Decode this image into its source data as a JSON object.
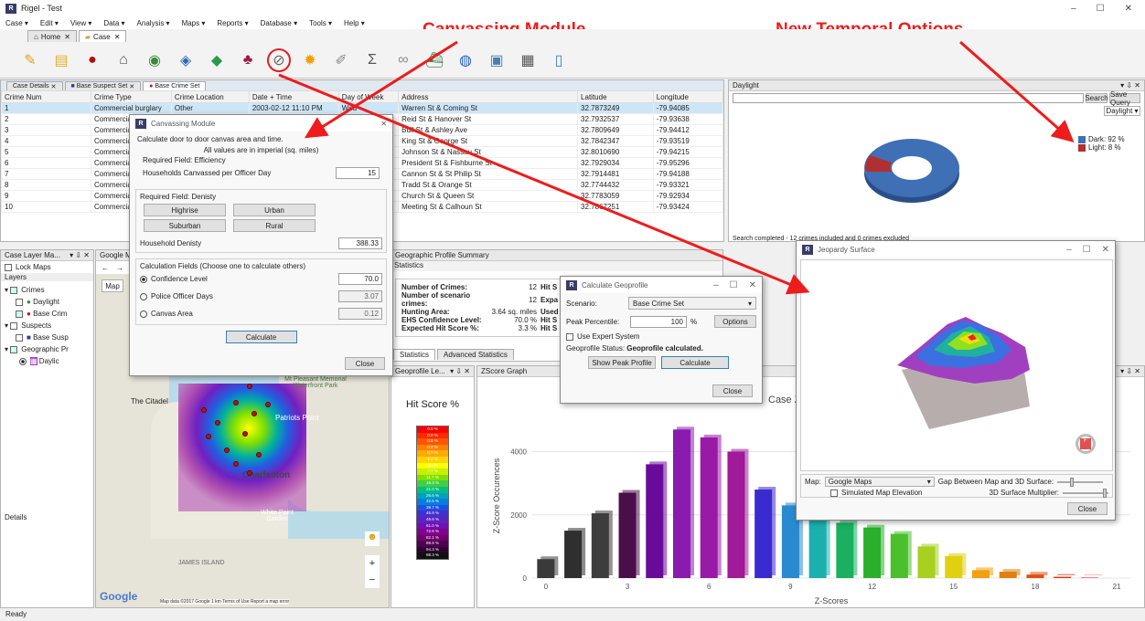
{
  "window": {
    "title": "Rigel - Test",
    "min": "–",
    "max": "☐",
    "close": "✕"
  },
  "menu": [
    "Case ▾",
    "Edit ▾",
    "View ▾",
    "Data ▾",
    "Analysis ▾",
    "Maps ▾",
    "Reports ▾",
    "Database ▾",
    "Tools ▾",
    "Help ▾"
  ],
  "doc_tabs": [
    {
      "label": "Home"
    },
    {
      "label": "Case"
    }
  ],
  "annotations": {
    "canvassing": "Canvassing Module",
    "temporal": "New Temporal Options"
  },
  "case_tabs": [
    {
      "label": "Case Details"
    },
    {
      "label": "Base Suspect Set"
    },
    {
      "label": "Base Crime Set"
    }
  ],
  "crime_table": {
    "columns": [
      "Crime Num",
      "Crime Type",
      "Crime Location",
      "Date + Time",
      "Day of Week",
      "Address",
      "Latitude",
      "Longitude"
    ],
    "rows": [
      [
        "1",
        "Commercial burglary",
        "Other",
        "2003-02-12 11:10 PM",
        "Wed",
        "Warren St & Coming St",
        "32.7873249",
        "-79.94085"
      ],
      [
        "2",
        "Commercial B",
        "",
        "",
        "",
        "Reid St & Hanover St",
        "32.7932537",
        "-79.93638"
      ],
      [
        "3",
        "Commercial B",
        "",
        "",
        "",
        "Bull St & Ashley Ave",
        "32.7809649",
        "-79.94412"
      ],
      [
        "4",
        "Commercial B",
        "",
        "",
        "",
        "King St & George St",
        "32.7842347",
        "-79.93519"
      ],
      [
        "5",
        "Commercial B",
        "",
        "",
        "",
        "Johnson St & Nassau St",
        "32.8010690",
        "-79.94215"
      ],
      [
        "6",
        "Commercial B",
        "",
        "",
        "",
        "President St & Fishburne St",
        "32.7929034",
        "-79.95296"
      ],
      [
        "7",
        "Commercial B",
        "",
        "",
        "",
        "Cannon St & St Philip St",
        "32.7914481",
        "-79.94188"
      ],
      [
        "8",
        "Commercial B",
        "",
        "",
        "",
        "Tradd St & Orange St",
        "32.7744432",
        "-79.93321"
      ],
      [
        "9",
        "Commercial B",
        "",
        "",
        "",
        "Church St & Queen St",
        "32.7783059",
        "-79.92934"
      ],
      [
        "10",
        "Commercial B",
        "",
        "",
        "",
        "Meeting St & Calhoun St",
        "32.7867251",
        "-79.93424"
      ]
    ]
  },
  "daylight": {
    "title": "Daylight",
    "search_label": "Search",
    "save_query_label": "Save Query",
    "dropdown_value": "Daylight",
    "legend": [
      {
        "label": "Dark: 92 %",
        "color": "#3f6fb5"
      },
      {
        "label": "Light: 8 %",
        "color": "#b03030"
      }
    ],
    "dark_pct": 92,
    "status": "Search completed - 12 crimes included and 0 crimes excluded"
  },
  "canvassing": {
    "title": "Canvassing Module",
    "intro": "Calculate door to door canvas area and time.",
    "units_note": "All values are in imperial (sq. miles)",
    "efficiency_group": "Required Field: Efficiency",
    "households_label": "Households Canvassed per Officer Day",
    "households_value": "15",
    "density_group": "Required Field: Denisty",
    "density_buttons": [
      "Highrise",
      "Urban",
      "Suburban",
      "Rural"
    ],
    "household_density_label": "Household Denisty",
    "household_density_value": "388.33",
    "calc_group": "Calculation Fields (Choose one to calculate others)",
    "confidence_label": "Confidence Level",
    "confidence_value": "70.0",
    "officer_days_label": "Police Officer Days",
    "officer_days_value": "3.07",
    "canvas_area_label": "Canvas Area",
    "canvas_area_value": "0.12",
    "calculate_label": "Calculate",
    "close_label": "Close"
  },
  "layers": {
    "panel_title": "Case Layer Ma...",
    "lock_maps": "Lock Maps",
    "layers_label": "Layers",
    "items": [
      "Crimes",
      "Daylight",
      "Base Crim",
      "Suspects",
      "Base Susp",
      "Geographic Pr",
      "Daylic"
    ],
    "details_label": "Details"
  },
  "map": {
    "title": "Google M",
    "type_button": "Map",
    "labels": [
      "The Citadel",
      "Patriots Point",
      "Mt Pleasant Memorial Waterfront Park",
      "Charleston",
      "White Point Garden",
      "JAMES ISLAND"
    ],
    "footer": "Map data ©2017 Google   1 km   Terms of Use   Report a map error",
    "logo": "Google"
  },
  "geo_summary": {
    "title": "Geographic Profile Summary",
    "stats_header": "Statistics",
    "rows": [
      {
        "label": "Number of Crimes:",
        "value": "12",
        "extra": "Hit S"
      },
      {
        "label": "Number of scenario crimes:",
        "value": "12",
        "extra": "Expa"
      },
      {
        "label": "Hunting Area:",
        "value": "3.64 sq. miles",
        "extra": "Used"
      },
      {
        "label": "EHS Confidence Level:",
        "value": "70.0 %",
        "extra": "Hit S"
      },
      {
        "label": "Expected Hit Score %:",
        "value": "3.3 %",
        "extra": "Hit S"
      }
    ],
    "tabs": [
      "Statistics",
      "Advanced Statistics"
    ]
  },
  "calc_geo": {
    "title": "Calculate Geoprofile",
    "scenario_label": "Scenario:",
    "scenario_value": "Base Crime Set",
    "peak_label": "Peak Percentile:",
    "peak_value": "100",
    "peak_unit": "%",
    "options_label": "Options",
    "expert_label": "Use Expert System",
    "status_label": "Geoprofile Status:",
    "status_value": "Geoprofile calculated.",
    "show_peak_label": "Show Peak Profile",
    "calculate_label": "Calculate",
    "close_label": "Close"
  },
  "hit_legend": {
    "panel_title": "Geoprofile Le...",
    "title": "Hit Score %",
    "items": [
      "0.0 %",
      "0.0 %",
      "0.0 %",
      "0.2 %",
      "0.7 %",
      "1.4 %",
      "4.6 %",
      "7.7 %",
      "11.7 %",
      "16.3 %",
      "21.0 %",
      "26.6 %",
      "32.5 %",
      "38.7 %",
      "45.9 %",
      "49.6 %",
      "61.0 %",
      "72.8 %",
      "82.1 %",
      "88.9 %",
      "94.3 %",
      "98.3 %"
    ],
    "colors": [
      "#ff0000",
      "#ff2a00",
      "#ff5500",
      "#ff8000",
      "#ffaa00",
      "#ffd400",
      "#ffff00",
      "#c8f000",
      "#80e000",
      "#40d040",
      "#00c080",
      "#00a0c0",
      "#0080e0",
      "#2050e0",
      "#4030d0",
      "#6020c0",
      "#7010b0",
      "#800090",
      "#700070",
      "#500050",
      "#300030",
      "#101010"
    ]
  },
  "zscore": {
    "title": "ZScore Graph",
    "chart_title": "Case Z"
  },
  "chart_data": {
    "type": "bar",
    "title": "Case Z",
    "xlabel": "Z-Scores",
    "ylabel": "Z-Score Occurences",
    "x": [
      0,
      1,
      2,
      3,
      4,
      5,
      6,
      7,
      8,
      9,
      10,
      11,
      12,
      13,
      14,
      15,
      16,
      17,
      18,
      19,
      20,
      21
    ],
    "values": [
      600,
      1500,
      2050,
      2700,
      3600,
      4700,
      4450,
      4000,
      2800,
      2300,
      1950,
      1750,
      1600,
      1400,
      1000,
      700,
      250,
      200,
      110,
      40,
      15,
      0
    ],
    "colors": [
      "#3a3a3a",
      "#2f2f2f",
      "#3d3d3d",
      "#4a0f4a",
      "#6a0a9a",
      "#8a1ab0",
      "#9a1aa8",
      "#a01a9a",
      "#3a2ad0",
      "#2a8ad0",
      "#1ab0b0",
      "#1ab060",
      "#2ab02a",
      "#4ac02a",
      "#a8d020",
      "#e0d010",
      "#f0a010",
      "#e08010",
      "#e05010",
      "#e03010",
      "#e01010",
      "#d00000"
    ],
    "xticks": [
      0,
      3,
      6,
      9,
      12,
      15,
      18,
      21
    ],
    "yticks": [
      0,
      2000,
      4000
    ],
    "ylim": [
      0,
      5200
    ]
  },
  "jeopardy": {
    "title": "Jeopardy Surface",
    "map_label": "Map:",
    "map_value": "Google Maps",
    "gap_label": "Gap Between Map and 3D Surface:",
    "elevation_label": "Simulated Map Elevation",
    "multiplier_label": "3D Surface Multiplier:",
    "close_label": "Close"
  },
  "status_bar": "Ready"
}
